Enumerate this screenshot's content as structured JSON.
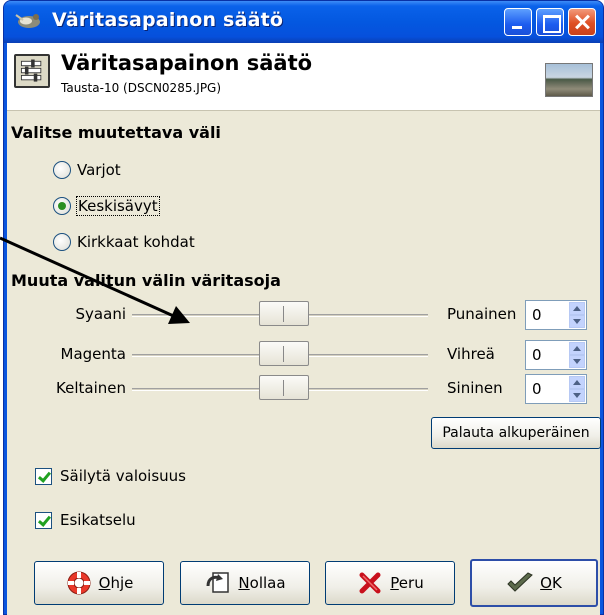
{
  "window": {
    "title": "Väritasapainon säätö"
  },
  "header": {
    "title": "Väritasapainon säätö",
    "subtitle": "Tausta-10 (DSCN0285.JPG)"
  },
  "range_section": {
    "title": "Valitse muutettava väli",
    "options": [
      {
        "label": "Varjot",
        "checked": false
      },
      {
        "label": "Keskisävyt",
        "checked": true
      },
      {
        "label": "Kirkkaat kohdat",
        "checked": false
      }
    ]
  },
  "levels_section": {
    "title": "Muuta valitun välin väritasoja",
    "sliders": [
      {
        "left": "Syaani",
        "right": "Punainen",
        "value": "0"
      },
      {
        "left": "Magenta",
        "right": "Vihreä",
        "value": "0"
      },
      {
        "left": "Keltainen",
        "right": "Sininen",
        "value": "0"
      }
    ],
    "reset_button": "Palauta alkuperäinen"
  },
  "checkboxes": [
    {
      "label": "Säilytä valoisuus",
      "checked": true
    },
    {
      "label": "Esikatselu",
      "checked": true
    }
  ],
  "buttons": {
    "help": {
      "mnemonic": "O",
      "rest": "hje"
    },
    "reset": {
      "mnemonic": "N",
      "rest": "ollaa"
    },
    "cancel": {
      "mnemonic": "P",
      "rest": "eru"
    },
    "ok": {
      "mnemonic": "O",
      "rest": "K"
    }
  },
  "colors": {
    "titlebar": "#0a55de",
    "dialog_bg": "#ece9d8",
    "close_button": "#df4f24"
  },
  "icons": [
    "gimp-icon",
    "minimize-icon",
    "maximize-icon",
    "close-icon",
    "color-balance-icon",
    "image-thumbnail",
    "help-lifebuoy-icon",
    "reset-icon",
    "cancel-x-icon",
    "ok-check-icon",
    "annotation-arrow"
  ]
}
